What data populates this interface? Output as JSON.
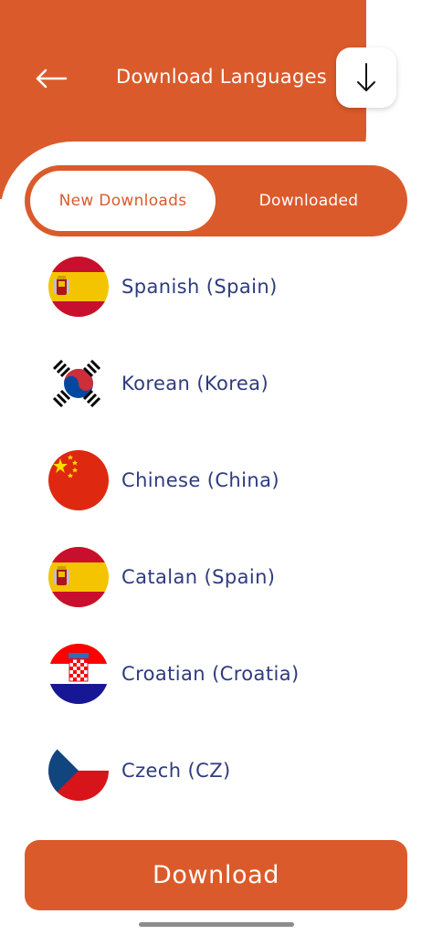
{
  "header": {
    "title": "Download Languages",
    "back_icon": "arrow-left-icon",
    "action_icon": "arrow-down-icon",
    "background_color": "#DB5A2B"
  },
  "tabs": [
    {
      "label": "New Downloads",
      "active": true
    },
    {
      "label": "Downloaded",
      "active": false
    }
  ],
  "languages": [
    {
      "label": "Spanish (Spain)",
      "flag": "spain-flag-icon"
    },
    {
      "label": "Korean (Korea)",
      "flag": "south-korea-flag-icon"
    },
    {
      "label": "Chinese (China)",
      "flag": "china-flag-icon"
    },
    {
      "label": "Catalan (Spain)",
      "flag": "spain-flag-icon"
    },
    {
      "label": "Croatian (Croatia)",
      "flag": "croatia-flag-icon"
    },
    {
      "label": "Czech (CZ)",
      "flag": "czech-flag-icon"
    }
  ],
  "footer": {
    "download_label": "Download"
  },
  "colors": {
    "accent": "#DB5A2B",
    "text_primary": "#2E3B7E"
  }
}
